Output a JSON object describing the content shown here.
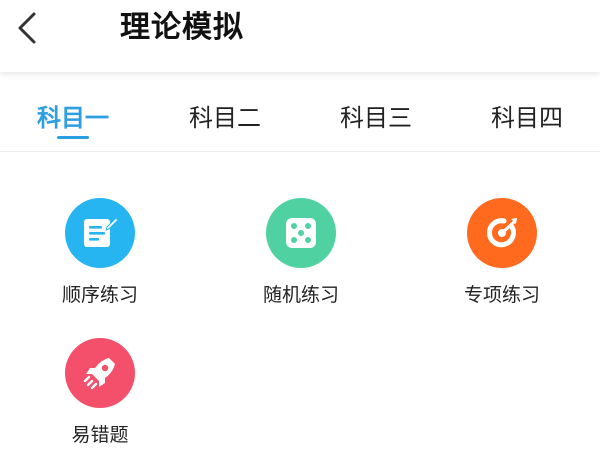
{
  "header": {
    "back_icon": "chevron-left-icon",
    "title": "理论模拟"
  },
  "tabs": [
    {
      "label": "科目一",
      "active": true
    },
    {
      "label": "科目二",
      "active": false
    },
    {
      "label": "科目三",
      "active": false
    },
    {
      "label": "科目四",
      "active": false
    }
  ],
  "colors": {
    "accent": "#2d9ee0",
    "sequential": "#27b5f2",
    "random": "#4fd1a1",
    "special": "#ff6a1f",
    "mistakes": "#f4506c"
  },
  "practice_items": [
    {
      "label": "顺序练习",
      "icon": "edit-document-icon"
    },
    {
      "label": "随机练习",
      "icon": "dice-icon"
    },
    {
      "label": "专项练习",
      "icon": "target-icon"
    },
    {
      "label": "易错题",
      "icon": "rocket-icon"
    }
  ]
}
